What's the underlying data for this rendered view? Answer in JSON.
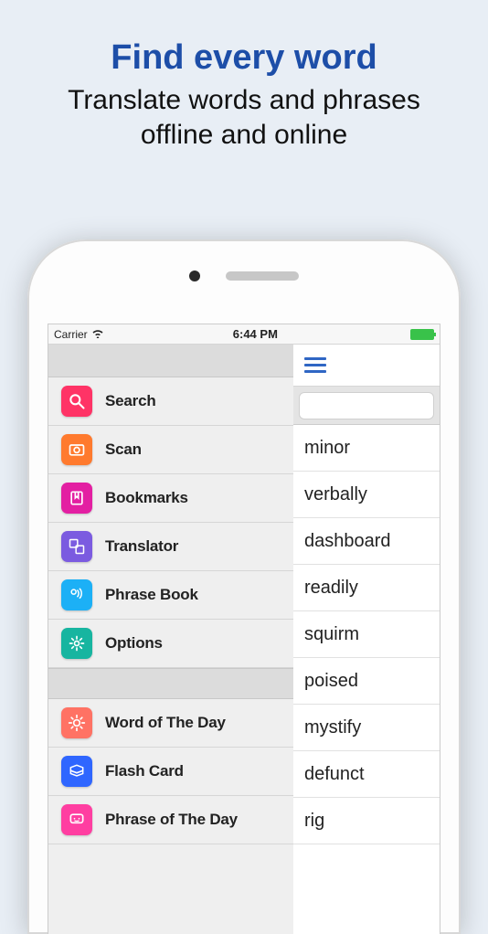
{
  "promo": {
    "title": "Find every word",
    "subtitle_line1": "Translate words and phrases",
    "subtitle_line2": "offline and online"
  },
  "status_bar": {
    "carrier": "Carrier",
    "time": "6:44 PM"
  },
  "drawer": {
    "section1": [
      {
        "label": "Search",
        "icon": "search-icon",
        "color": "#ff3366"
      },
      {
        "label": "Scan",
        "icon": "camera-icon",
        "color": "#ff7a2e"
      },
      {
        "label": "Bookmarks",
        "icon": "bookmark-icon",
        "color": "#e31fa2"
      },
      {
        "label": "Translator",
        "icon": "translate-icon",
        "color": "#7b5be0"
      },
      {
        "label": "Phrase Book",
        "icon": "speaker-icon",
        "color": "#1cb0f6"
      },
      {
        "label": "Options",
        "icon": "gear-icon",
        "color": "#17b5a0"
      }
    ],
    "section2": [
      {
        "label": "Word of The Day",
        "icon": "sun-icon",
        "color": "#ff7264"
      },
      {
        "label": "Flash Card",
        "icon": "card-icon",
        "color": "#2f66ff"
      },
      {
        "label": "Phrase of The Day",
        "icon": "chat-icon",
        "color": "#ff3ea1"
      }
    ]
  },
  "word_list": [
    "minor",
    "verbally",
    "dashboard",
    "readily",
    "squirm",
    "poised",
    "mystify",
    "defunct",
    "rig"
  ]
}
